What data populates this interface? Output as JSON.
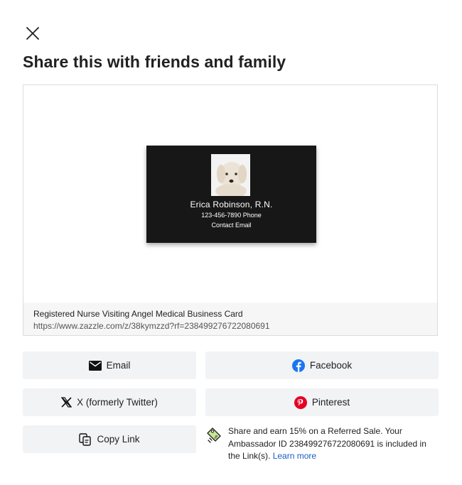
{
  "dialog": {
    "title": "Share this with friends and family",
    "close_icon": "close-icon"
  },
  "preview": {
    "card": {
      "name": "Erica Robinson, R.N.",
      "phone": "123-456-7890 Phone",
      "email": "Contact Email"
    },
    "product_title": "Registered Nurse Visiting Angel Medical Business Card",
    "product_url": "https://www.zazzle.com/z/38kymzzd?rf=238499276722080691"
  },
  "share_buttons": {
    "email": {
      "label": "Email",
      "icon": "envelope-icon"
    },
    "facebook": {
      "label": "Facebook",
      "icon": "facebook-icon",
      "color": "#1877f2"
    },
    "twitter": {
      "label": "X (formerly Twitter)",
      "icon": "x-logo-icon"
    },
    "pinterest": {
      "label": "Pinterest",
      "icon": "pinterest-icon",
      "color": "#e60023"
    },
    "copy": {
      "label": "Copy Link",
      "icon": "copy-icon"
    }
  },
  "ambassador": {
    "text": "Share and earn 15% on a Referred Sale. Your Ambassador ID 238499276722080691 is included in the Link(s). ",
    "learn_more": "Learn more",
    "icon": "ambassador-tag-icon",
    "link_color": "#1a5dbf"
  }
}
